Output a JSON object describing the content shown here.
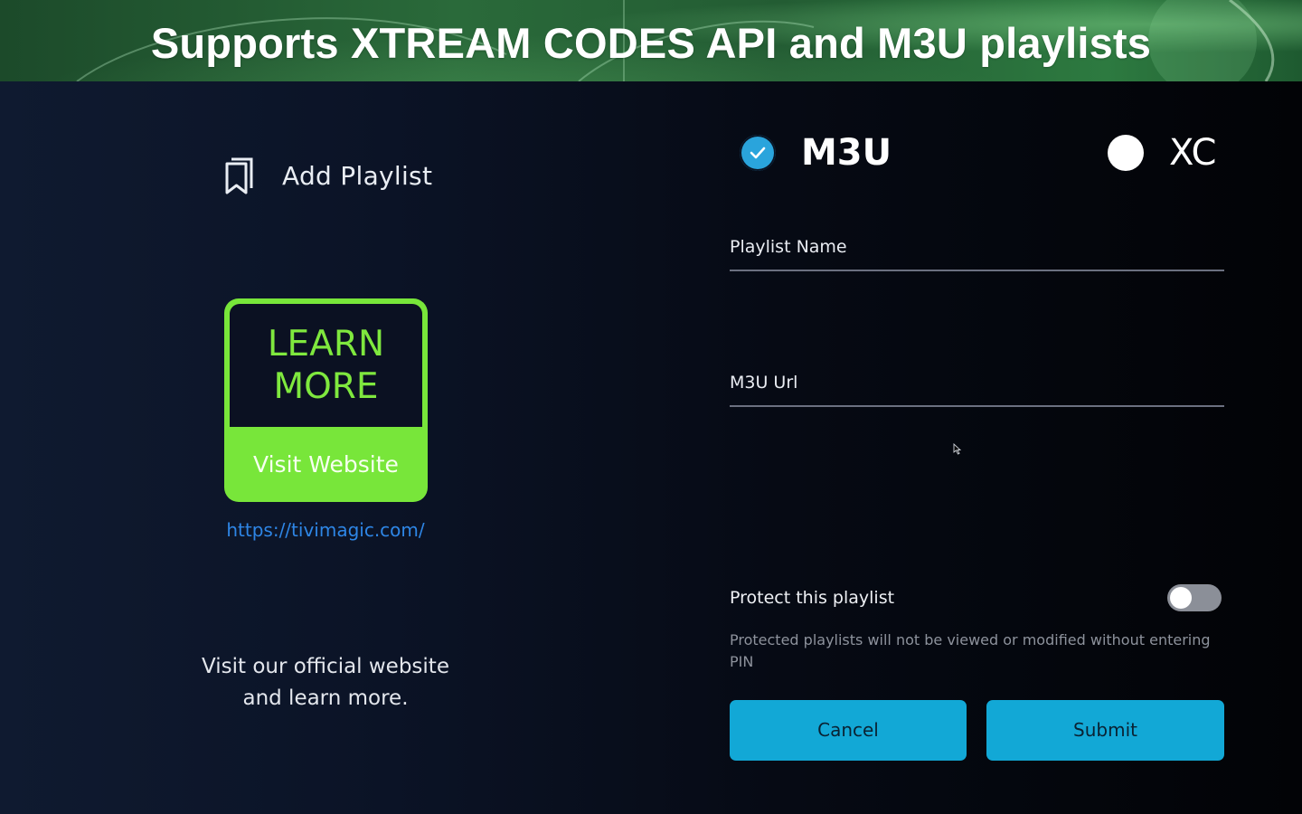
{
  "banner": {
    "title": "Supports XTREAM CODES API and M3U playlists"
  },
  "left_panel": {
    "add_playlist_label": "Add Playlist",
    "add_playlist_icon": "bookmarks-icon",
    "learn_more_line1": "LEARN",
    "learn_more_line2": "MORE",
    "visit_website_label": "Visit Website",
    "website_link": "https://tivimagic.com/",
    "info_line1": "Visit our official website",
    "info_line2": "and learn more."
  },
  "playlist_type": {
    "options": [
      {
        "label": "M3U",
        "selected": true
      },
      {
        "label": "XC",
        "selected": false
      }
    ]
  },
  "form": {
    "playlist_name_placeholder": "Playlist Name",
    "m3u_url_placeholder": "M3U Url",
    "protect_label": "Protect this playlist",
    "protect_enabled": false,
    "protect_description": "Protected playlists will not be viewed or modified without entering PIN",
    "cancel_label": "Cancel",
    "submit_label": "Submit"
  },
  "colors": {
    "accent_green": "#78e63a",
    "button_blue": "#12a8d6",
    "link_blue": "#2e86e6",
    "radio_checked": "#2aa4dc"
  }
}
